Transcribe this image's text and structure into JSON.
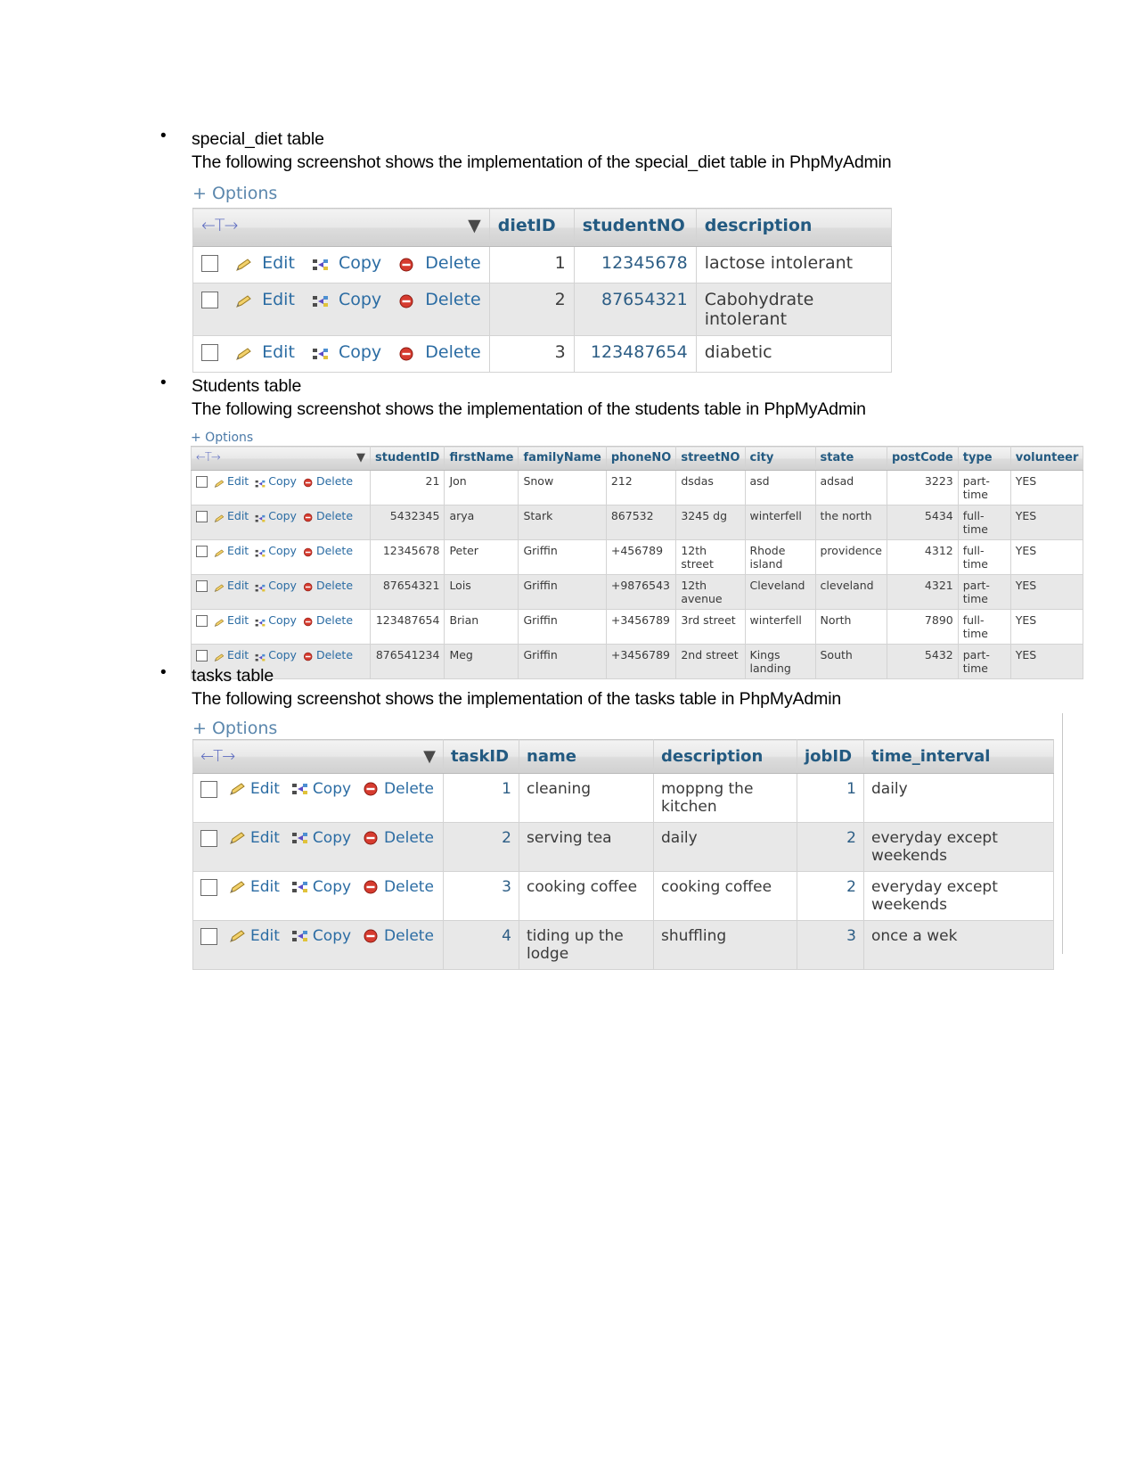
{
  "document": {
    "sections": [
      {
        "heading": "special_diet table",
        "paragraph": "The following screenshot shows the implementation of the special_diet table in PhpMyAdmin"
      },
      {
        "heading": "Students table",
        "paragraph": "The following screenshot shows the implementation of the students table in PhpMyAdmin"
      },
      {
        "heading": "tasks table",
        "paragraph": "The following screenshot shows the implementation of the tasks table in PhpMyAdmin"
      }
    ]
  },
  "phpmyadmin": {
    "options_label": "+ Options",
    "actions": {
      "edit": "Edit",
      "copy": "Copy",
      "delete": "Delete"
    },
    "nav_arrows": "←T→",
    "icons": {
      "edit": "pencil-icon",
      "copy": "copy-icon",
      "delete": "delete-icon",
      "sort": "chevron-down-icon",
      "checkbox": "row-checkbox"
    },
    "colors": {
      "link": "#2b6ca3",
      "header_text": "#235a81",
      "delete_icon": "#cc2222",
      "row_alt": "#e8e8e8"
    }
  },
  "tables": {
    "special_diet": {
      "columns": [
        "dietID",
        "studentNO",
        "description"
      ],
      "rows": [
        {
          "dietID": "1",
          "studentNO": "12345678",
          "description": "lactose intolerant"
        },
        {
          "dietID": "2",
          "studentNO": "87654321",
          "description": "Cabohydrate intolerant"
        },
        {
          "dietID": "3",
          "studentNO": "123487654",
          "description": "diabetic"
        }
      ]
    },
    "students": {
      "columns": [
        "studentID",
        "firstName",
        "familyName",
        "phoneNO",
        "streetNO",
        "city",
        "state",
        "postCode",
        "type",
        "volunteer"
      ],
      "rows": [
        {
          "studentID": "21",
          "firstName": "Jon",
          "familyName": "Snow",
          "phoneNO": "212",
          "streetNO": "dsdas",
          "city": "asd",
          "state": "adsad",
          "postCode": "3223",
          "type": "part-time",
          "volunteer": "YES"
        },
        {
          "studentID": "5432345",
          "firstName": "arya",
          "familyName": "Stark",
          "phoneNO": "867532",
          "streetNO": "3245 dg",
          "city": "winterfell",
          "state": "the north",
          "postCode": "5434",
          "type": "full-time",
          "volunteer": "YES"
        },
        {
          "studentID": "12345678",
          "firstName": "Peter",
          "familyName": "Griffin",
          "phoneNO": "+456789",
          "streetNO": "12th street",
          "city": "Rhode island",
          "state": "providence",
          "postCode": "4312",
          "type": "full-time",
          "volunteer": "YES"
        },
        {
          "studentID": "87654321",
          "firstName": "Lois",
          "familyName": "Griffin",
          "phoneNO": "+9876543",
          "streetNO": "12th avenue",
          "city": "Cleveland",
          "state": "cleveland",
          "postCode": "4321",
          "type": "part-time",
          "volunteer": "YES"
        },
        {
          "studentID": "123487654",
          "firstName": "Brian",
          "familyName": "Griffin",
          "phoneNO": "+3456789",
          "streetNO": "3rd street",
          "city": "winterfell",
          "state": "North",
          "postCode": "7890",
          "type": "full-time",
          "volunteer": "YES"
        },
        {
          "studentID": "876541234",
          "firstName": "Meg",
          "familyName": "Griffin",
          "phoneNO": "+3456789",
          "streetNO": "2nd street",
          "city": "Kings landing",
          "state": "South",
          "postCode": "5432",
          "type": "part-time",
          "volunteer": "YES"
        }
      ]
    },
    "tasks": {
      "columns": [
        "taskID",
        "name",
        "description",
        "jobID",
        "time_interval"
      ],
      "rows": [
        {
          "taskID": "1",
          "name": "cleaning",
          "description": "moppng the kitchen",
          "jobID": "1",
          "time_interval": "daily"
        },
        {
          "taskID": "2",
          "name": "serving tea",
          "description": "daily",
          "jobID": "2",
          "time_interval": "everyday except weekends"
        },
        {
          "taskID": "3",
          "name": "cooking coffee",
          "description": "cooking coffee",
          "jobID": "2",
          "time_interval": "everyday except weekends"
        },
        {
          "taskID": "4",
          "name": "tiding up the lodge",
          "description": "shuffling",
          "jobID": "3",
          "time_interval": "once a wek"
        }
      ]
    }
  }
}
